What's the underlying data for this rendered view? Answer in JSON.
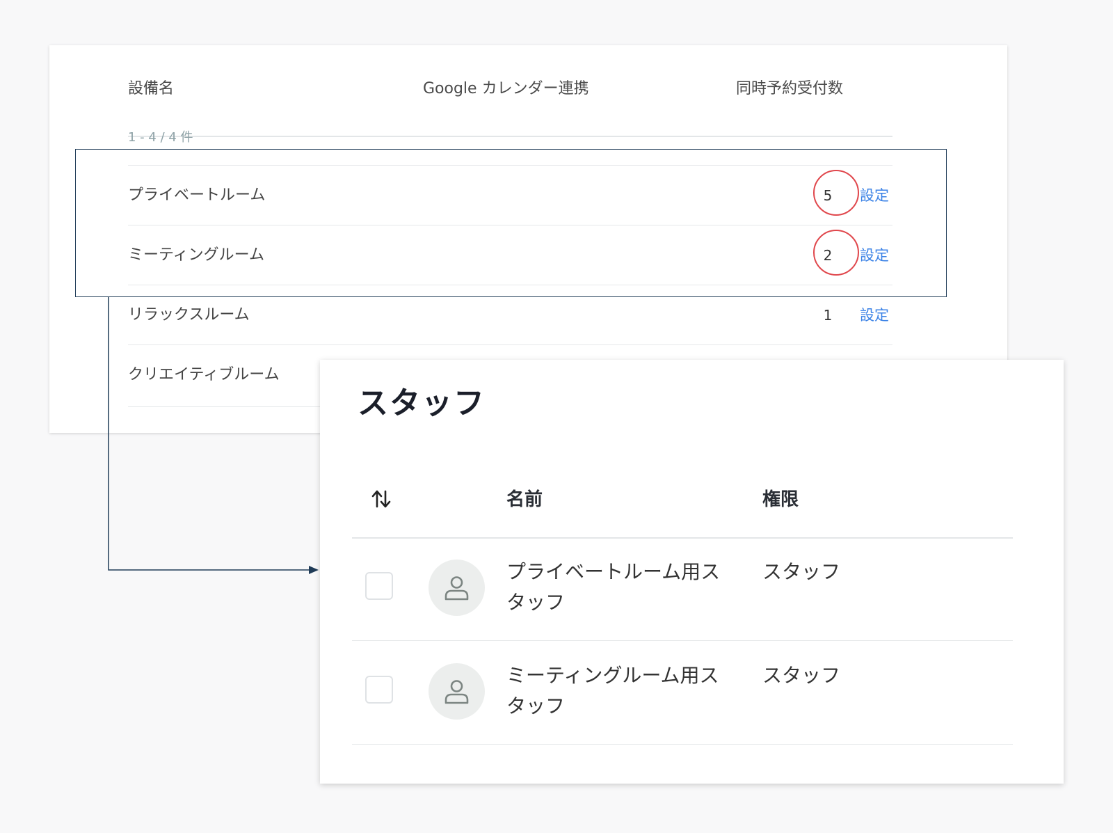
{
  "facilities": {
    "headers": {
      "name": "設備名",
      "google": "Google カレンダー連携",
      "count": "同時予約受付数"
    },
    "count_label": "1 - 4 / 4 件",
    "rows": [
      {
        "name": "プライベートルーム",
        "count": "5",
        "setting": "設定"
      },
      {
        "name": "ミーティングルーム",
        "count": "2",
        "setting": "設定"
      },
      {
        "name": "リラックスルーム",
        "count": "1",
        "setting": "設定"
      },
      {
        "name": "クリエイティブルーム",
        "count": "",
        "setting": ""
      }
    ]
  },
  "staff": {
    "title": "スタッフ",
    "headers": {
      "sort_icon": "sort-arrows-icon",
      "name": "名前",
      "role": "権限"
    },
    "rows": [
      {
        "name": "プライベートルーム用スタッフ",
        "role": "スタッフ",
        "avatar_icon": "user-icon"
      },
      {
        "name": "ミーティングルーム用スタッフ",
        "role": "スタッフ",
        "avatar_icon": "user-icon"
      }
    ]
  },
  "colors": {
    "link": "#3b82e6",
    "highlight_circle": "#e0474c",
    "highlight_box": "#1f3b57"
  }
}
